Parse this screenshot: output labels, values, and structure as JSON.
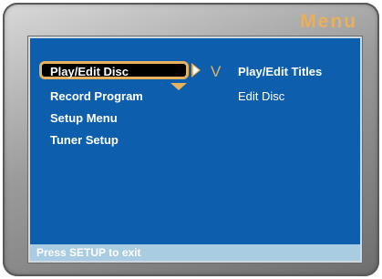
{
  "header": {
    "title": "Menu"
  },
  "left_menu": {
    "items": [
      {
        "label": "Play/Edit Disc",
        "selected": true
      },
      {
        "label": "Record Program",
        "selected": false
      },
      {
        "label": "Setup Menu",
        "selected": false
      },
      {
        "label": "Tuner Setup",
        "selected": false
      }
    ]
  },
  "submenu": {
    "indicator": "V",
    "items": [
      {
        "label": "Play/Edit Titles"
      },
      {
        "label": "Edit Disc"
      }
    ]
  },
  "status_bar": {
    "text": "Press SETUP to exit"
  },
  "colors": {
    "screen_bg": "#0d5fae",
    "accent": "#e8b05c",
    "status_bar_bg": "#aacce3",
    "selected_bg": "#000000"
  }
}
